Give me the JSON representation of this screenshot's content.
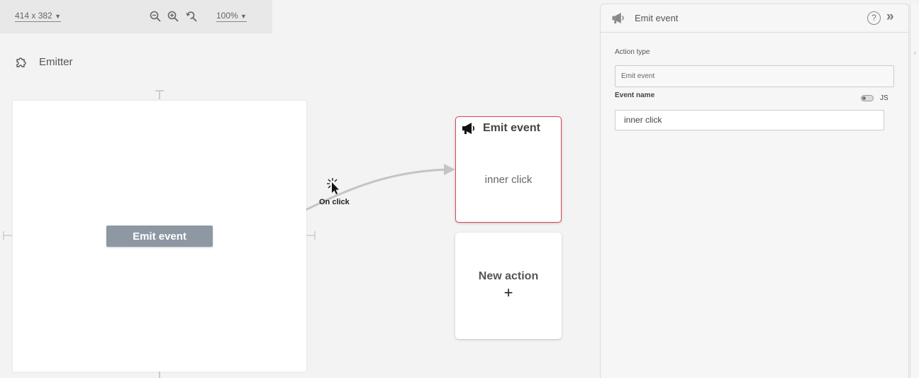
{
  "toolbar": {
    "size_label": "414 x 382",
    "zoom_label": "100%",
    "icons": [
      "zoom-out-icon",
      "zoom-in-icon",
      "zoom-reset-icon",
      "chevron-down-icon"
    ]
  },
  "component": {
    "icon": "puzzle-icon",
    "name": "Emitter"
  },
  "canvas": {
    "button_label": "Emit event"
  },
  "connection": {
    "trigger_label": "On click",
    "icon": "cursor-click-icon",
    "line_color": "#c4c4c4"
  },
  "cards": {
    "emit": {
      "icon": "megaphone-icon",
      "title": "Emit event",
      "value": "inner click",
      "border_color": "#d9485c"
    },
    "new_action": {
      "title": "New action",
      "plus": "+"
    }
  },
  "panel": {
    "icon": "megaphone-icon",
    "title": "Emit event",
    "help": "?",
    "collapse": "»",
    "action_type_label": "Action type",
    "action_type_value": "Emit event",
    "event_name_label": "Event name",
    "js_label": "JS",
    "event_name_value": "inner click"
  }
}
